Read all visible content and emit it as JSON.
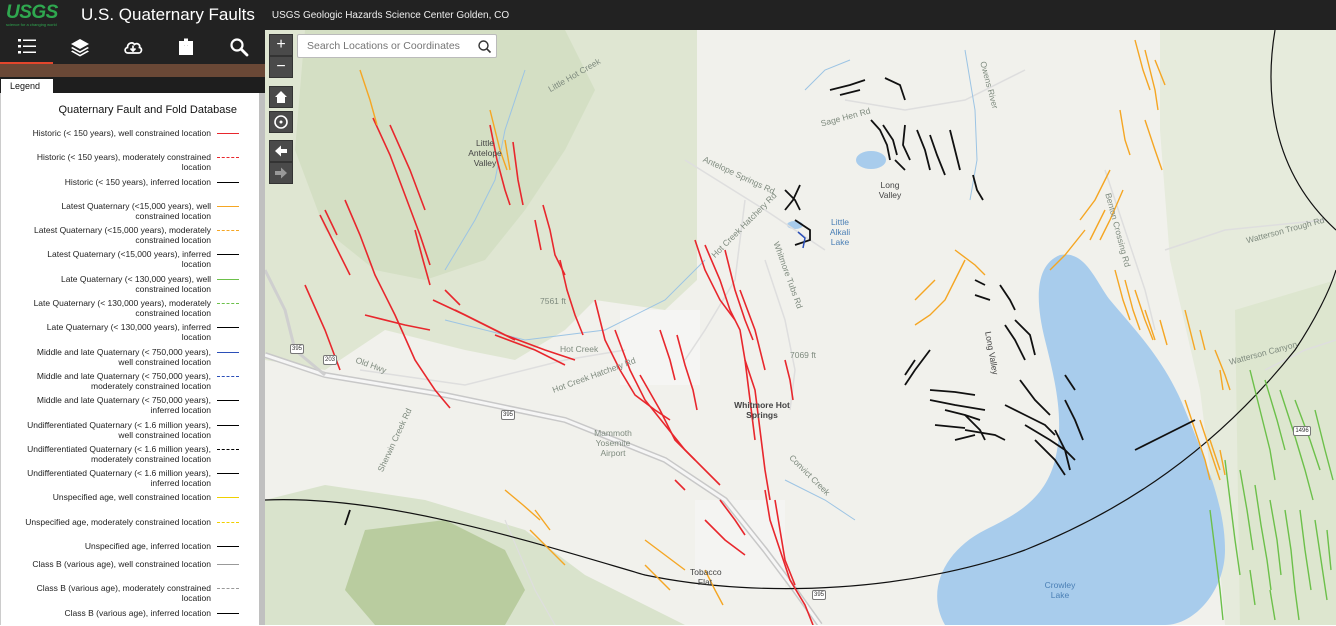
{
  "header": {
    "logo_text": "USGS",
    "logo_tagline": "science for a changing world",
    "title": "U.S. Quaternary Faults",
    "subtitle": "USGS Geologic Hazards Science Center Golden, CO"
  },
  "toolbar": {
    "items": [
      "list-icon",
      "layers-icon",
      "cloud-download-icon",
      "bookmark-icon",
      "search-icon"
    ]
  },
  "panel": {
    "tab_label": "Legend",
    "title": "Quaternary Fault and Fold Database",
    "items": [
      {
        "label": "Historic (< 150 years), well constrained location",
        "color": "#e8272d",
        "style": "solid"
      },
      {
        "label": "Historic (< 150 years), moderately constrained location",
        "color": "#e8272d",
        "style": "dashed"
      },
      {
        "label": "Historic (< 150 years), inferred location",
        "color": "#000000",
        "style": "solid"
      },
      {
        "label": "Latest Quaternary (<15,000 years), well constrained location",
        "color": "#f5a623",
        "style": "solid"
      },
      {
        "label": "Latest Quaternary (<15,000 years), moderately constrained location",
        "color": "#f5a623",
        "style": "dashed"
      },
      {
        "label": "Latest Quaternary (<15,000 years), inferred location",
        "color": "#000000",
        "style": "solid"
      },
      {
        "label": "Late Quaternary (< 130,000 years), well constrained location",
        "color": "#6cc04a",
        "style": "solid"
      },
      {
        "label": "Late Quaternary (< 130,000 years), moderately constrained location",
        "color": "#6cc04a",
        "style": "dashed"
      },
      {
        "label": "Late Quaternary (< 130,000 years), inferred location",
        "color": "#000000",
        "style": "solid"
      },
      {
        "label": "Middle and late Quaternary (< 750,000 years), well constrained location",
        "color": "#2b4fb8",
        "style": "solid"
      },
      {
        "label": "Middle and late Quaternary (< 750,000 years), moderately constrained location",
        "color": "#2b4fb8",
        "style": "dashed"
      },
      {
        "label": "Middle and late Quaternary (< 750,000 years), inferred location",
        "color": "#000000",
        "style": "solid"
      },
      {
        "label": "Undifferentiated Quaternary (< 1.6 million years), well constrained location",
        "color": "#000000",
        "style": "solid"
      },
      {
        "label": "Undifferentiated Quaternary (< 1.6 million years), moderately constrained location",
        "color": "#000000",
        "style": "dashed"
      },
      {
        "label": "Undifferentiated Quaternary (< 1.6 million years), inferred location",
        "color": "#000000",
        "style": "solid"
      },
      {
        "label": "Unspecified age, well constrained location",
        "color": "#f0d000",
        "style": "solid"
      },
      {
        "label": "Unspecified age, moderately constrained location",
        "color": "#f0d000",
        "style": "dashed"
      },
      {
        "label": "Unspecified age, inferred location",
        "color": "#000000",
        "style": "solid"
      },
      {
        "label": "Class B (various age), well constrained location",
        "color": "#999999",
        "style": "solid"
      },
      {
        "label": "Class B (various age), moderately constrained location",
        "color": "#999999",
        "style": "dashed"
      },
      {
        "label": "Class B (various age), inferred location",
        "color": "#000000",
        "style": "solid"
      }
    ]
  },
  "map": {
    "search_placeholder": "Search Locations or Coordinates",
    "controls": {
      "zoom_in": "+",
      "zoom_out": "−"
    },
    "labels": {
      "little_antelope_valley": "Little Antelope Valley",
      "long_valley_n": "Long Valley",
      "long_valley_s": "Long Valley",
      "little_alkali_lake": "Little Alkali Lake",
      "whitmore_hot_springs": "Whitmore Hot Springs",
      "mammoth_airport": "Mammoth Yosemite Airport",
      "tobacco_flat": "Tobacco Flat",
      "crowley_lake": "Crowley Lake",
      "watterson_canyon": "Watterson Canyon",
      "watterson_trough_rd": "Watterson Trough Rd",
      "benton_crossing_rd": "Benton Crossing Rd",
      "sage_hen_rd": "Sage Hen Rd",
      "antelope_springs_rd": "Antelope Springs Rd",
      "hot_creek_hatchery_rd": "Hot Creek Hatchery Rd",
      "whitmore_tubs_rd": "Whitmore Tubs Rd",
      "hot_creek": "Hot Creek",
      "convict_creek": "Convict Creek",
      "sherwin_creek_rd": "Sherwin Creek Rd",
      "old_hwy": "Old Hwy",
      "little_hot_creek": "Little Hot Creek",
      "owens_river": "Owens River",
      "elev_7561": "7561 ft",
      "elev_7069": "7069 ft",
      "hwy_395_a": "395",
      "hwy_395_b": "395",
      "hwy_395_c": "395",
      "hwy_203": "203",
      "rt_1496": "1496"
    }
  }
}
